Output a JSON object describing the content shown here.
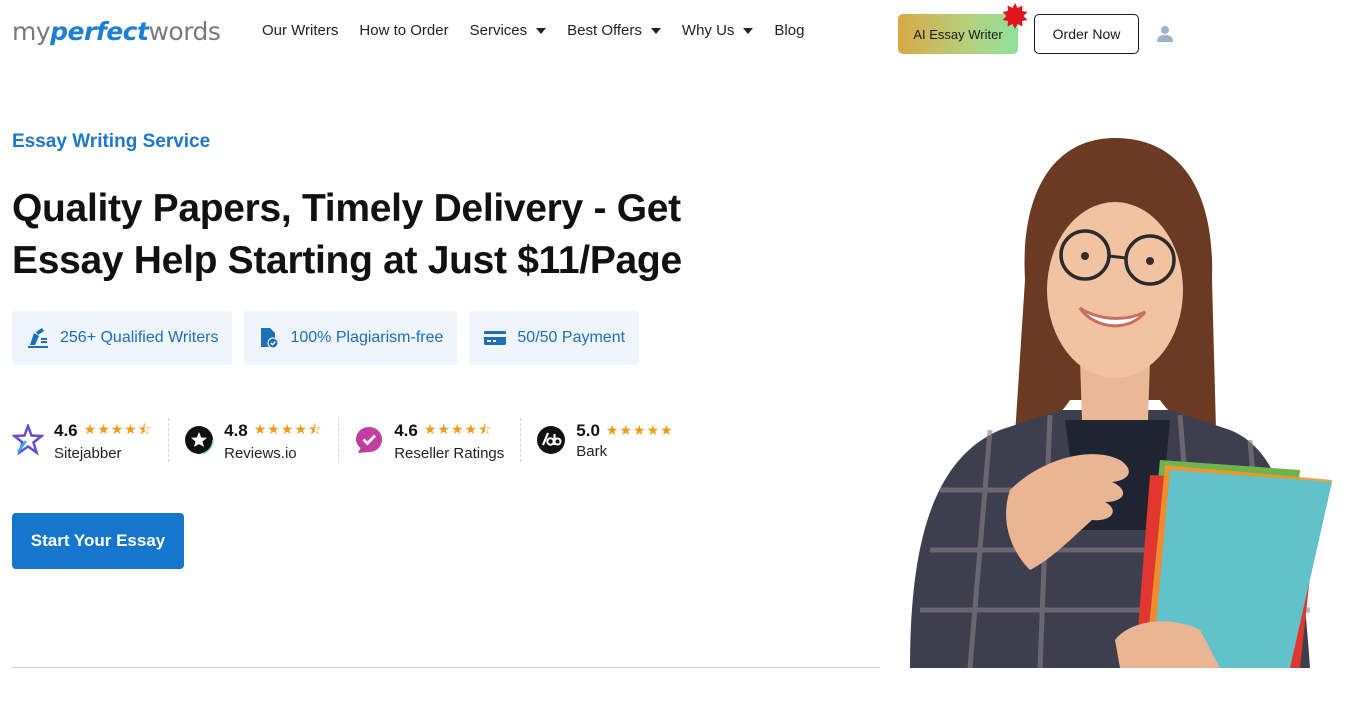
{
  "header": {
    "logo": {
      "part1": "my",
      "part2": "perfect",
      "part3": "words"
    },
    "nav": [
      {
        "label": "Our Writers",
        "dropdown": false
      },
      {
        "label": "How to Order",
        "dropdown": false
      },
      {
        "label": "Services",
        "dropdown": true
      },
      {
        "label": "Best Offers",
        "dropdown": true
      },
      {
        "label": "Why Us",
        "dropdown": true
      },
      {
        "label": "Blog",
        "dropdown": false
      }
    ],
    "ai_button": "AI Essay Writer",
    "order_button": "Order Now",
    "user_icon": "user-icon"
  },
  "hero": {
    "eyebrow": "Essay Writing Service",
    "headline_line1": "Quality Papers, Timely Delivery - Get",
    "headline_line2": "Essay Help Starting at Just $11/Page",
    "features": [
      {
        "icon": "writer-icon",
        "label": "256+ Qualified Writers"
      },
      {
        "icon": "document-check-icon",
        "label": "100% Plagiarism-free"
      },
      {
        "icon": "credit-card-icon",
        "label": "50/50 Payment"
      }
    ],
    "ratings": [
      {
        "icon": "sitejabber-icon",
        "score": "4.6",
        "stars": 4.6,
        "name": "Sitejabber"
      },
      {
        "icon": "reviewsio-icon",
        "score": "4.8",
        "stars": 4.8,
        "name": "Reviews.io"
      },
      {
        "icon": "reseller-ratings-icon",
        "score": "4.6",
        "stars": 4.6,
        "name": "Reseller Ratings"
      },
      {
        "icon": "bark-icon",
        "score": "5.0",
        "stars": 5.0,
        "name": "Bark"
      }
    ],
    "cta": "Start Your Essay"
  },
  "colors": {
    "brand_blue": "#1675cc",
    "star_orange": "#f39a1d",
    "feature_bg": "#eef5fc",
    "burst_red": "#e3141b"
  }
}
